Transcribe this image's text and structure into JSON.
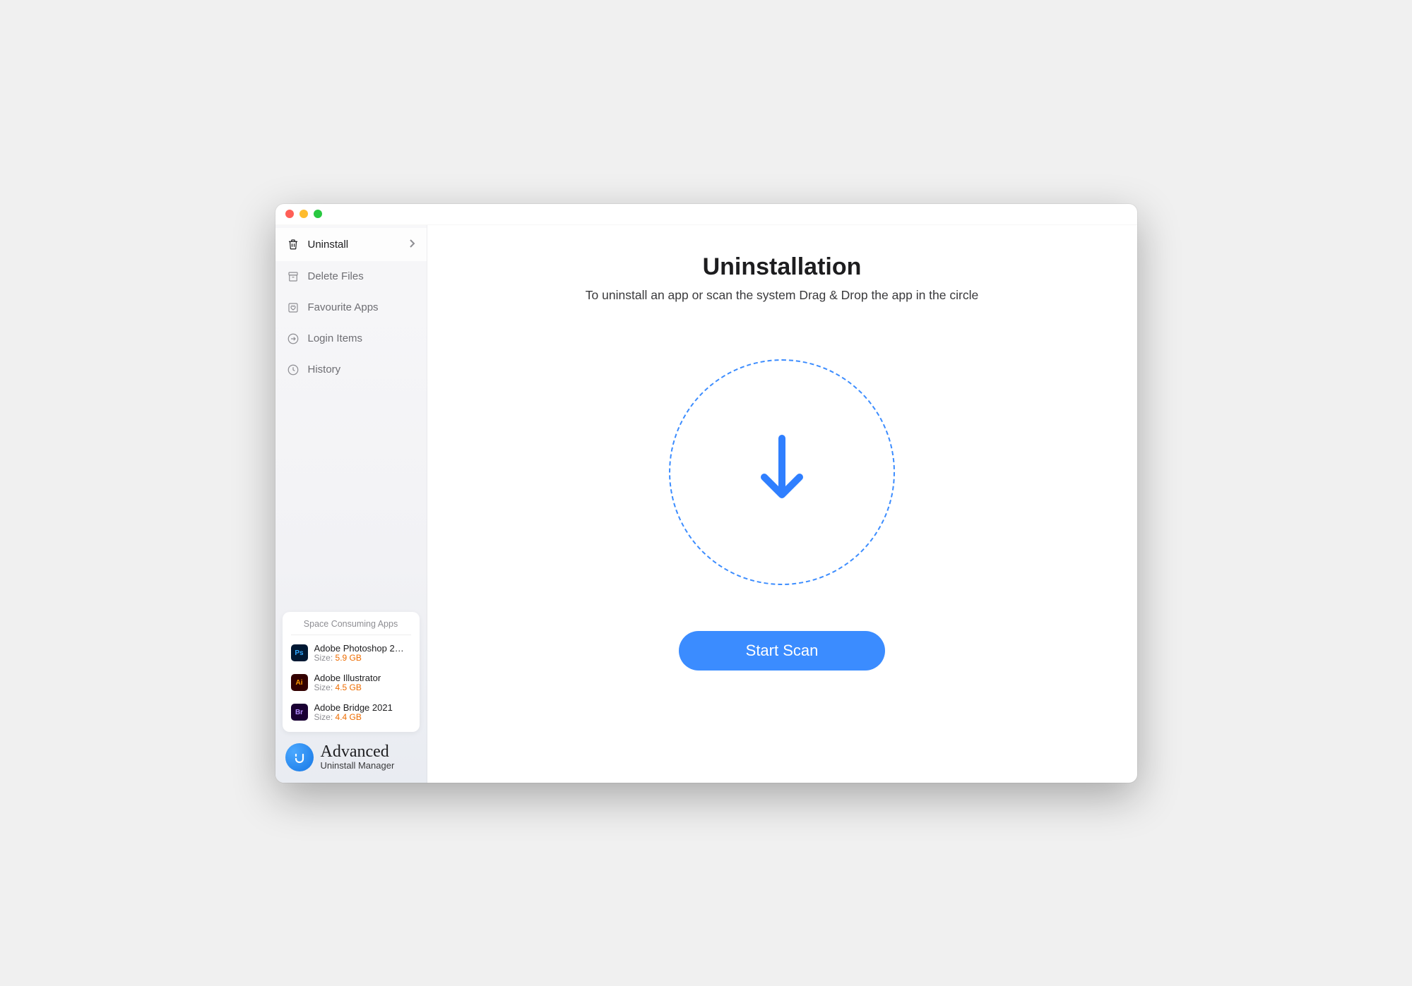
{
  "sidebar": {
    "items": [
      {
        "label": "Uninstall",
        "icon": "trash-icon",
        "active": true
      },
      {
        "label": "Delete Files",
        "icon": "archive-icon",
        "active": false
      },
      {
        "label": "Favourite Apps",
        "icon": "heart-box-icon",
        "active": false
      },
      {
        "label": "Login Items",
        "icon": "login-arrow-icon",
        "active": false
      },
      {
        "label": "History",
        "icon": "clock-icon",
        "active": false
      }
    ]
  },
  "space_card": {
    "title": "Space Consuming Apps",
    "apps": [
      {
        "name": "Adobe Photoshop 2…",
        "size_label": "Size:",
        "size": "5.9 GB",
        "badge": "Ps",
        "icon_class": "icon-ps"
      },
      {
        "name": "Adobe Illustrator",
        "size_label": "Size:",
        "size": "4.5 GB",
        "badge": "Ai",
        "icon_class": "icon-ai"
      },
      {
        "name": "Adobe Bridge 2021",
        "size_label": "Size:",
        "size": "4.4 GB",
        "badge": "Br",
        "icon_class": "icon-br"
      }
    ]
  },
  "branding": {
    "main": "Advanced",
    "sub": "Uninstall Manager"
  },
  "main": {
    "title": "Uninstallation",
    "subtitle": "To uninstall an app or scan the system Drag & Drop the app in the circle",
    "button": "Start Scan"
  }
}
